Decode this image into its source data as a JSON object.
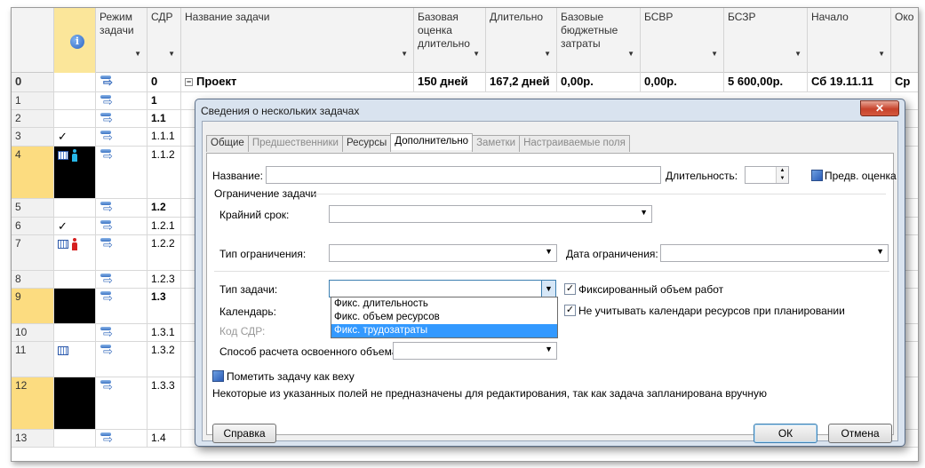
{
  "columns": {
    "id": "",
    "indicators": "",
    "mode": "Режим задачи",
    "wbs": "СДР",
    "name": "Название задачи",
    "baseline_estimate": "Базовая оценка длительно",
    "duration": "Длительно",
    "baseline_budget": "Базовые бюджетные затраты",
    "bcwp": "БСВР",
    "bcws": "БСЗР",
    "start": "Начало",
    "finish": "Око"
  },
  "rows": [
    {
      "id": "0",
      "wbs": "0",
      "name": "Проект",
      "baseline_estimate": "150 дней",
      "duration": "167,2 дней",
      "baseline_budget": "0,00р.",
      "bcwp": "0,00р.",
      "bcws": "5 600,00р.",
      "start": "Сб 19.11.11",
      "finish": "Ср"
    },
    {
      "id": "1",
      "wbs": "1"
    },
    {
      "id": "2",
      "wbs": "1.1"
    },
    {
      "id": "3",
      "wbs": "1.1.1"
    },
    {
      "id": "4",
      "wbs": "1.1.2"
    },
    {
      "id": "5",
      "wbs": "1.2"
    },
    {
      "id": "6",
      "wbs": "1.2.1"
    },
    {
      "id": "7",
      "wbs": "1.2.2"
    },
    {
      "id": "8",
      "wbs": "1.2.3"
    },
    {
      "id": "9",
      "wbs": "1.3"
    },
    {
      "id": "10",
      "wbs": "1.3.1"
    },
    {
      "id": "11",
      "wbs": "1.3.2"
    },
    {
      "id": "12",
      "wbs": "1.3.3"
    },
    {
      "id": "13",
      "wbs": "1.4"
    }
  ],
  "dialog": {
    "title": "Сведения о нескольких задачах",
    "close": "✕",
    "tabs": [
      "Общие",
      "Предшественники",
      "Ресурсы",
      "Дополнительно",
      "Заметки",
      "Настраиваемые поля"
    ],
    "name_label": "Название:",
    "name_value": "",
    "duration_label": "Длительность:",
    "duration_value": "",
    "estimated_label": "Предв. оценка",
    "constraint_group": "Ограничение задачи",
    "deadline_label": "Крайний срок:",
    "deadline_value": "",
    "constraint_type_label": "Тип ограничения:",
    "constraint_type_value": "",
    "constraint_date_label": "Дата ограничения:",
    "constraint_date_value": "",
    "task_type_label": "Тип задачи:",
    "task_type_value": "",
    "task_type_options": [
      "Фикс. длительность",
      "Фикс. объем ресурсов",
      "Фикс. трудозатраты"
    ],
    "task_type_highlighted": 2,
    "effort_driven_label": "Фиксированный объем работ",
    "effort_driven_checked": true,
    "calendar_label": "Календарь:",
    "ignore_calendars_label": "Не учитывать календари ресурсов при планировании",
    "ignore_calendars_checked": true,
    "wbs_code_label": "Код СДР:",
    "earned_value_label": "Способ расчета освоенного объема:",
    "earned_value_value": "",
    "milestone_label": "Пометить задачу как веху",
    "note": "Некоторые из указанных полей не предназначены для редактирования, так как задача запланирована вручную",
    "help_button": "Справка",
    "ok_button": "ОК",
    "cancel_button": "Отмена"
  },
  "colors": {
    "indicator_yellow": "#fbe69a",
    "selected_row_id": "#fcdc80",
    "dialog_frame": "#d9e3ef",
    "highlight": "#3399ff"
  }
}
